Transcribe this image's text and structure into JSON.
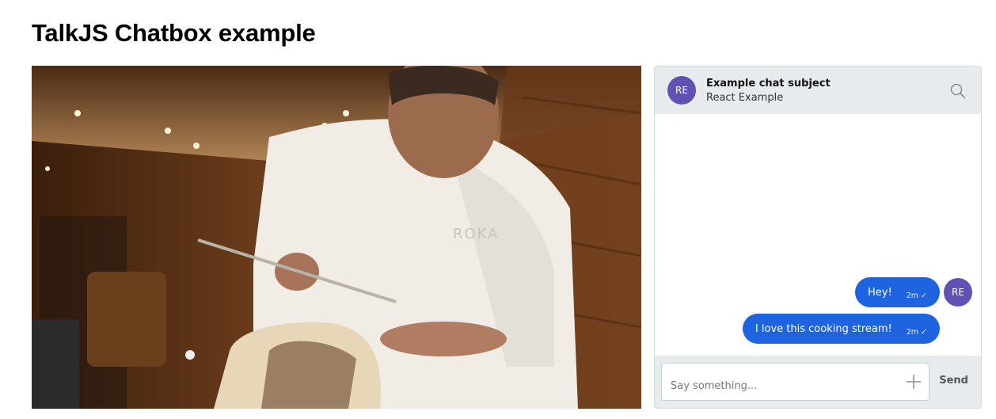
{
  "page": {
    "title": "TalkJS Chatbox example"
  },
  "video": {
    "subject": "chef plating dish",
    "apron_text": "ROKA"
  },
  "chat": {
    "header": {
      "avatar_initials": "RE",
      "subject": "Example chat subject",
      "subtitle": "React Example",
      "search_icon": "search-icon"
    },
    "messages": [
      {
        "text": "Hey!",
        "time": "2m ✓"
      },
      {
        "text": "I love this cooking stream!",
        "time": "2m ✓"
      }
    ],
    "sender_avatar_initials": "RE",
    "composer": {
      "placeholder": "Say something...",
      "send_label": "Send",
      "attach_icon": "plus-icon"
    }
  },
  "colors": {
    "avatar": "#6052b5",
    "bubble": "#1e63e0",
    "header_bg": "#e7ebee"
  }
}
